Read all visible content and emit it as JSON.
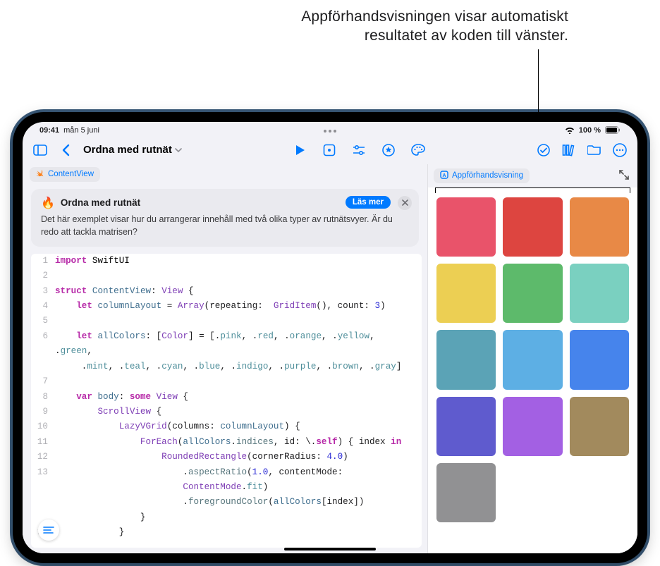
{
  "annotation": {
    "line1": "Appförhandsvisningen visar automatiskt",
    "line2": "resultatet av koden till vänster."
  },
  "status": {
    "time": "09:41",
    "date": "mån 5 juni",
    "battery_text": "100 %"
  },
  "toolbar": {
    "title": "Ordna med rutnät"
  },
  "file_tab": {
    "label": "ContentView"
  },
  "info_card": {
    "title": "Ordna med rutnät",
    "desc": "Det här exemplet visar hur du arrangerar innehåll med två olika typer av rutnätsvyer. Är du redo att tackla matrisen?",
    "button": "Läs mer"
  },
  "preview_tab": {
    "label": "Appförhandsvisning"
  },
  "code": [
    {
      "n": "1",
      "html": "<span class='k-kw'>import</span> <span class='k-sys'>SwiftUI</span>"
    },
    {
      "n": "2",
      "html": ""
    },
    {
      "n": "3",
      "html": "<span class='k-kw'>struct</span> <span class='k-id'>ContentView</span>: <span class='k-prot'>View</span> {"
    },
    {
      "n": "4",
      "html": "    <span class='k-kw'>let</span> <span class='k-id'>columnLayout</span> = <span class='k-type'>Array</span>(repeating:  <span class='k-type'>GridItem</span>(), count: <span class='k-num'>3</span>)"
    },
    {
      "n": "5",
      "html": ""
    },
    {
      "n": "6",
      "html": "    <span class='k-kw'>let</span> <span class='k-id'>allColors</span>: [<span class='k-type'>Color</span>] = [.<span class='k-mem'>pink</span>, .<span class='k-mem'>red</span>, .<span class='k-mem'>orange</span>, .<span class='k-mem'>yellow</span>, .<span class='k-mem'>green</span>,"
    },
    {
      "n": "",
      "html": "     .<span class='k-mem'>mint</span>, .<span class='k-mem'>teal</span>, .<span class='k-mem'>cyan</span>, .<span class='k-mem'>blue</span>, .<span class='k-mem'>indigo</span>, .<span class='k-mem'>purple</span>, .<span class='k-mem'>brown</span>, .<span class='k-mem'>gray</span>]"
    },
    {
      "n": "7",
      "html": ""
    },
    {
      "n": "8",
      "html": "    <span class='k-kw'>var</span> <span class='k-id'>body</span>: <span class='k-kw'>some</span> <span class='k-prot'>View</span> {"
    },
    {
      "n": "9",
      "html": "        <span class='k-type'>ScrollView</span> {"
    },
    {
      "n": "10",
      "html": "            <span class='k-type'>LazyVGrid</span>(columns: <span class='k-id'>columnLayout</span>) {"
    },
    {
      "n": "11",
      "html": "                <span class='k-type'>ForEach</span>(<span class='k-id'>allColors</span>.<span class='k-fn'>indices</span>, id: \\.<span class='k-kw'>self</span>) { index <span class='k-kw'>in</span>"
    },
    {
      "n": "12",
      "html": "                    <span class='k-type'>RoundedRectangle</span>(cornerRadius: <span class='k-num'>4.0</span>)"
    },
    {
      "n": "13",
      "html": "                        .<span class='k-fn'>aspectRatio</span>(<span class='k-num'>1.0</span>, contentMode:"
    },
    {
      "n": "",
      "html": "                        <span class='k-type'>ContentMode</span>.<span class='k-mem'>fit</span>)"
    },
    {
      "n": "",
      "html": "                        .<span class='k-fn'>foregroundColor</span>(<span class='k-id'>allColors</span>[index])"
    },
    {
      "n": "",
      "html": "                }"
    },
    {
      "n": "16",
      "html": "            }"
    }
  ],
  "swatches": [
    "#e9536a",
    "#dd4540",
    "#e88946",
    "#eccf53",
    "#5dba6b",
    "#7ad0c0",
    "#5ba3b6",
    "#5dafe4",
    "#4684ec",
    "#5f5bce",
    "#a360e3",
    "#a28a5d",
    "#919193"
  ]
}
